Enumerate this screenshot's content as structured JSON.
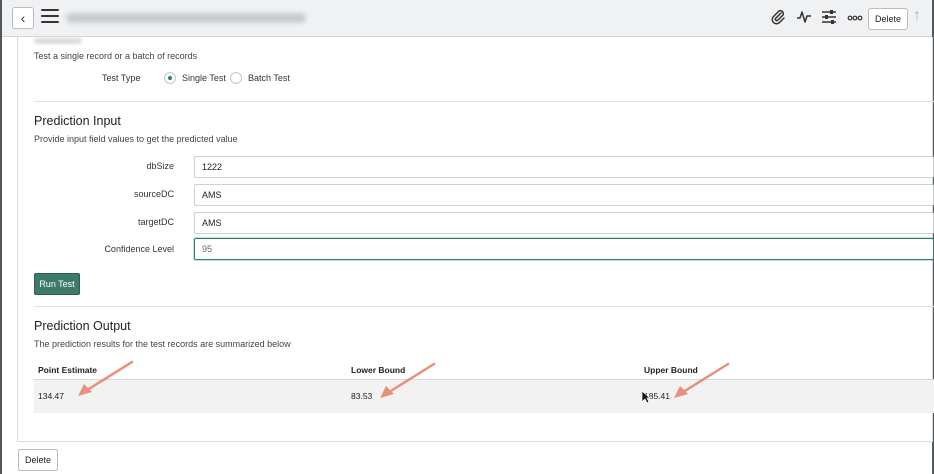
{
  "toolbar": {
    "back_icon": "chevron-left-icon",
    "menu_icon": "hamburger-menu-icon",
    "attachment_icon": "paperclip-icon",
    "activity_icon": "pulse-icon",
    "settings_icon": "sliders-icon",
    "more_icon": "ellipsis-icon",
    "delete_label": "Delete",
    "up_icon": "arrow-up-icon"
  },
  "test": {
    "description": "Test a single record or a batch of records",
    "type_label": "Test Type",
    "options": [
      {
        "label": "Single Test",
        "checked": true
      },
      {
        "label": "Batch Test",
        "checked": false
      }
    ]
  },
  "prediction_input": {
    "title": "Prediction Input",
    "description": "Provide input field values to get the predicted value",
    "fields": [
      {
        "label": "dbSize",
        "value": "1222"
      },
      {
        "label": "sourceDC",
        "value": "AMS"
      },
      {
        "label": "targetDC",
        "value": "AMS"
      },
      {
        "label": "Confidence Level",
        "value": "95"
      }
    ],
    "run_label": "Run Test"
  },
  "prediction_output": {
    "title": "Prediction Output",
    "description": "The prediction results for the test records are summarized below",
    "columns": [
      "Point Estimate",
      "Lower Bound",
      "Upper Bound"
    ],
    "row": [
      "134.47",
      "83.53",
      "185.41"
    ]
  },
  "footer": {
    "delete_label": "Delete"
  },
  "colors": {
    "accent": "#3d7a6a",
    "annotation_arrow": "#e8907a"
  }
}
